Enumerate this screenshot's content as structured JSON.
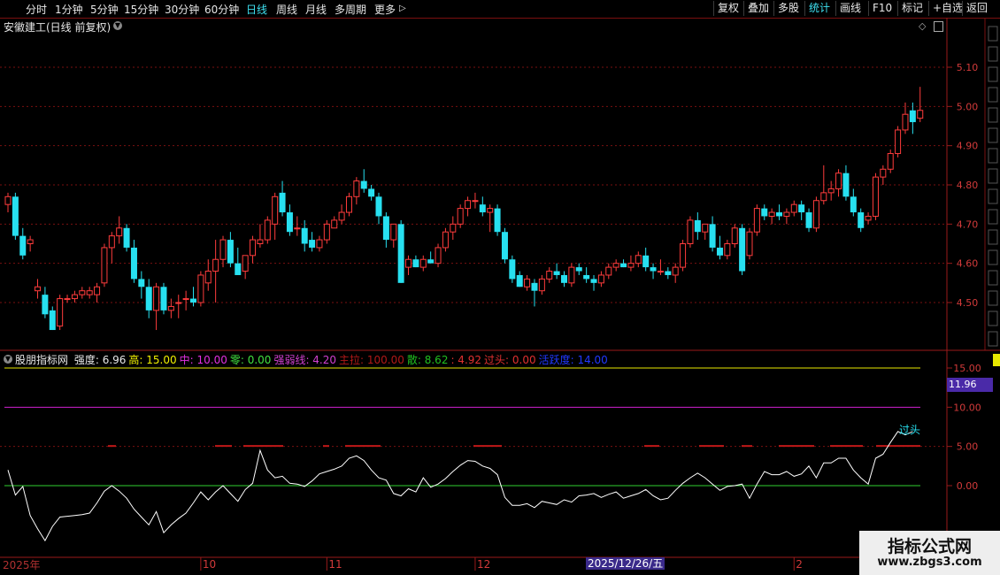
{
  "toolbar": {
    "periods": [
      "分时",
      "1分钟",
      "5分钟",
      "15分钟",
      "30分钟",
      "60分钟",
      "日线",
      "周线",
      "月线",
      "多周期",
      "更多"
    ],
    "active_period": "日线",
    "right_buttons": [
      "复权",
      "叠加",
      "多股",
      "统计",
      "画线",
      "F10",
      "标记",
      "+自选",
      "返回"
    ],
    "active_right": "统计"
  },
  "stock": {
    "title": "安徽建工(日线 前复权)"
  },
  "price_axis": {
    "labels": [
      "5.10",
      "5.00",
      "4.90",
      "4.80",
      "4.70",
      "4.60",
      "4.50"
    ]
  },
  "indicator": {
    "name": "股朋指标网",
    "items": [
      {
        "label": "强度: 6.96",
        "color": "#e8e8e8"
      },
      {
        "label": "高: 15.00",
        "color": "#f0f000"
      },
      {
        "label": "中: 10.00",
        "color": "#e030e0"
      },
      {
        "label": "零: 0.00",
        "color": "#40e040"
      },
      {
        "label": "强弱线: 4.20",
        "color": "#d040d0"
      },
      {
        "label": "主拉: 100.00",
        "color": "#b01818"
      },
      {
        "label": "散: 8.62",
        "color": "#20c020"
      },
      {
        "label": ": 4.92",
        "color": "#e03030"
      },
      {
        "label": "过头: 0.00",
        "color": "#e03030"
      },
      {
        "label": "活跃度: 14.00",
        "color": "#2038ff"
      }
    ],
    "axis_labels": [
      "15.00",
      "10.00",
      "5.00",
      "0.00"
    ],
    "current_value": "11.96",
    "annotation": "过头"
  },
  "time_axis": {
    "labels": [
      {
        "text": "2025年",
        "idx": 0
      },
      {
        "text": "10",
        "idx": 26
      },
      {
        "text": "11",
        "idx": 43
      },
      {
        "text": "12",
        "idx": 63
      },
      {
        "text": "2",
        "idx": 106
      }
    ],
    "selected_date": "2025/12/26/五"
  },
  "watermark": {
    "line1": "指标公式网",
    "line2": "www.zbgs3.com"
  },
  "colors": {
    "up": "#ff3c3c",
    "down": "#27e0f0",
    "grid": "#7a1010",
    "osc": "#ffffff",
    "bg": "#000000"
  },
  "chart_data": {
    "type": "candlestick",
    "ohlc": [
      [
        4.75,
        4.78,
        4.73,
        4.77
      ],
      [
        4.77,
        4.78,
        4.66,
        4.67
      ],
      [
        4.67,
        4.69,
        4.61,
        4.62
      ],
      [
        4.65,
        4.67,
        4.63,
        4.66
      ],
      [
        4.53,
        4.56,
        4.51,
        4.54
      ],
      [
        4.52,
        4.54,
        4.46,
        4.47
      ],
      [
        4.48,
        4.49,
        4.43,
        4.43
      ],
      [
        4.44,
        4.52,
        4.43,
        4.51
      ],
      [
        4.51,
        4.52,
        4.5,
        4.51
      ],
      [
        4.51,
        4.53,
        4.5,
        4.52
      ],
      [
        4.52,
        4.54,
        4.51,
        4.53
      ],
      [
        4.52,
        4.54,
        4.51,
        4.53
      ],
      [
        4.52,
        4.55,
        4.5,
        4.54
      ],
      [
        4.55,
        4.65,
        4.54,
        4.64
      ],
      [
        4.64,
        4.68,
        4.6,
        4.67
      ],
      [
        4.67,
        4.72,
        4.65,
        4.69
      ],
      [
        4.69,
        4.7,
        4.63,
        4.64
      ],
      [
        4.64,
        4.66,
        4.55,
        4.56
      ],
      [
        4.56,
        4.58,
        4.51,
        4.54
      ],
      [
        4.54,
        4.56,
        4.46,
        4.48
      ],
      [
        4.48,
        4.55,
        4.43,
        4.54
      ],
      [
        4.54,
        4.55,
        4.47,
        4.48
      ],
      [
        4.48,
        4.51,
        4.46,
        4.49
      ],
      [
        4.5,
        4.52,
        4.46,
        4.5
      ],
      [
        4.51,
        4.53,
        4.48,
        4.51
      ],
      [
        4.51,
        4.54,
        4.49,
        4.5
      ],
      [
        4.5,
        4.58,
        4.49,
        4.57
      ],
      [
        4.55,
        4.61,
        4.53,
        4.58
      ],
      [
        4.58,
        4.66,
        4.5,
        4.61
      ],
      [
        4.61,
        4.67,
        4.59,
        4.66
      ],
      [
        4.66,
        4.68,
        4.59,
        4.6
      ],
      [
        4.6,
        4.64,
        4.57,
        4.57
      ],
      [
        4.58,
        4.62,
        4.56,
        4.62
      ],
      [
        4.62,
        4.67,
        4.6,
        4.66
      ],
      [
        4.65,
        4.7,
        4.64,
        4.66
      ],
      [
        4.66,
        4.72,
        4.65,
        4.71
      ],
      [
        4.7,
        4.78,
        4.66,
        4.77
      ],
      [
        4.78,
        4.81,
        4.72,
        4.73
      ],
      [
        4.73,
        4.75,
        4.67,
        4.68
      ],
      [
        4.69,
        4.72,
        4.67,
        4.69
      ],
      [
        4.69,
        4.71,
        4.63,
        4.65
      ],
      [
        4.66,
        4.68,
        4.63,
        4.64
      ],
      [
        4.64,
        4.67,
        4.63,
        4.66
      ],
      [
        4.66,
        4.71,
        4.65,
        4.7
      ],
      [
        4.69,
        4.72,
        4.69,
        4.71
      ],
      [
        4.71,
        4.75,
        4.7,
        4.73
      ],
      [
        4.73,
        4.78,
        4.72,
        4.77
      ],
      [
        4.77,
        4.82,
        4.75,
        4.81
      ],
      [
        4.81,
        4.84,
        4.78,
        4.79
      ],
      [
        4.79,
        4.8,
        4.76,
        4.77
      ],
      [
        4.77,
        4.78,
        4.7,
        4.72
      ],
      [
        4.72,
        4.73,
        4.64,
        4.66
      ],
      [
        4.66,
        4.7,
        4.64,
        4.7
      ],
      [
        4.7,
        4.71,
        4.55,
        4.55
      ],
      [
        4.59,
        4.62,
        4.57,
        4.61
      ],
      [
        4.61,
        4.62,
        4.59,
        4.59
      ],
      [
        4.59,
        4.62,
        4.58,
        4.61
      ],
      [
        4.61,
        4.63,
        4.6,
        4.6
      ],
      [
        4.6,
        4.65,
        4.59,
        4.64
      ],
      [
        4.64,
        4.69,
        4.63,
        4.68
      ],
      [
        4.68,
        4.72,
        4.66,
        4.7
      ],
      [
        4.7,
        4.75,
        4.69,
        4.74
      ],
      [
        4.74,
        4.77,
        4.72,
        4.76
      ],
      [
        4.76,
        4.78,
        4.74,
        4.76
      ],
      [
        4.75,
        4.77,
        4.72,
        4.73
      ],
      [
        4.73,
        4.75,
        4.68,
        4.74
      ],
      [
        4.74,
        4.75,
        4.67,
        4.68
      ],
      [
        4.68,
        4.69,
        4.6,
        4.61
      ],
      [
        4.61,
        4.62,
        4.55,
        4.56
      ],
      [
        4.57,
        4.58,
        4.54,
        4.54
      ],
      [
        4.54,
        4.57,
        4.53,
        4.56
      ],
      [
        4.55,
        4.56,
        4.49,
        4.53
      ],
      [
        4.53,
        4.57,
        4.52,
        4.56
      ],
      [
        4.56,
        4.59,
        4.55,
        4.58
      ],
      [
        4.58,
        4.6,
        4.56,
        4.57
      ],
      [
        4.57,
        4.58,
        4.54,
        4.55
      ],
      [
        4.55,
        4.6,
        4.54,
        4.59
      ],
      [
        4.59,
        4.6,
        4.57,
        4.58
      ],
      [
        4.57,
        4.59,
        4.55,
        4.56
      ],
      [
        4.56,
        4.57,
        4.53,
        4.55
      ],
      [
        4.55,
        4.58,
        4.54,
        4.57
      ],
      [
        4.57,
        4.6,
        4.56,
        4.59
      ],
      [
        4.59,
        4.61,
        4.58,
        4.6
      ],
      [
        4.6,
        4.61,
        4.59,
        4.59
      ],
      [
        4.59,
        4.62,
        4.58,
        4.6
      ],
      [
        4.6,
        4.63,
        4.59,
        4.62
      ],
      [
        4.62,
        4.64,
        4.58,
        4.59
      ],
      [
        4.59,
        4.6,
        4.56,
        4.58
      ],
      [
        4.58,
        4.61,
        4.57,
        4.58
      ],
      [
        4.58,
        4.59,
        4.56,
        4.57
      ],
      [
        4.57,
        4.6,
        4.55,
        4.59
      ],
      [
        4.59,
        4.66,
        4.58,
        4.65
      ],
      [
        4.65,
        4.72,
        4.64,
        4.71
      ],
      [
        4.71,
        4.73,
        4.66,
        4.68
      ],
      [
        4.68,
        4.7,
        4.66,
        4.7
      ],
      [
        4.7,
        4.72,
        4.63,
        4.64
      ],
      [
        4.64,
        4.67,
        4.61,
        4.62
      ],
      [
        4.62,
        4.66,
        4.61,
        4.65
      ],
      [
        4.65,
        4.7,
        4.64,
        4.69
      ],
      [
        4.69,
        4.7,
        4.57,
        4.58
      ],
      [
        4.62,
        4.69,
        4.61,
        4.68
      ],
      [
        4.68,
        4.75,
        4.67,
        4.74
      ],
      [
        4.74,
        4.75,
        4.71,
        4.72
      ],
      [
        4.72,
        4.74,
        4.7,
        4.73
      ],
      [
        4.73,
        4.75,
        4.71,
        4.72
      ],
      [
        4.72,
        4.74,
        4.7,
        4.73
      ],
      [
        4.73,
        4.76,
        4.72,
        4.75
      ],
      [
        4.75,
        4.76,
        4.71,
        4.73
      ],
      [
        4.73,
        4.74,
        4.68,
        4.69
      ],
      [
        4.69,
        4.77,
        4.68,
        4.76
      ],
      [
        4.76,
        4.85,
        4.75,
        4.78
      ],
      [
        4.78,
        4.81,
        4.76,
        4.79
      ],
      [
        4.79,
        4.84,
        4.77,
        4.83
      ],
      [
        4.83,
        4.85,
        4.76,
        4.77
      ],
      [
        4.77,
        4.79,
        4.72,
        4.73
      ],
      [
        4.73,
        4.74,
        4.68,
        4.69
      ],
      [
        4.71,
        4.73,
        4.7,
        4.72
      ],
      [
        4.72,
        4.83,
        4.71,
        4.82
      ],
      [
        4.82,
        4.85,
        4.8,
        4.84
      ],
      [
        4.84,
        4.89,
        4.83,
        4.88
      ],
      [
        4.88,
        4.95,
        4.87,
        4.94
      ],
      [
        4.94,
        5.01,
        4.93,
        4.98
      ],
      [
        4.99,
        5.01,
        4.93,
        4.96
      ],
      [
        4.97,
        5.05,
        4.96,
        4.99
      ]
    ],
    "oscillator": [
      2.0,
      -1.2,
      -0.1,
      -3.8,
      -5.5,
      -7.0,
      -5.2,
      -4.0,
      -3.9,
      -3.8,
      -3.7,
      -3.5,
      -2.2,
      -0.7,
      0.0,
      -0.7,
      -1.6,
      -3.0,
      -4.0,
      -5.0,
      -3.3,
      -6.0,
      -5.0,
      -4.2,
      -3.5,
      -2.2,
      -0.8,
      -1.8,
      -0.8,
      0.0,
      -1.0,
      -2.0,
      -0.5,
      0.3,
      4.5,
      2.0,
      1.0,
      1.2,
      0.3,
      0.2,
      -0.1,
      0.6,
      1.5,
      1.8,
      2.1,
      2.5,
      3.5,
      3.8,
      3.2,
      2.0,
      1.0,
      0.7,
      -1.0,
      -1.3,
      -0.4,
      -0.8,
      1.0,
      -0.2,
      0.2,
      0.9,
      1.8,
      2.6,
      3.2,
      3.1,
      2.5,
      2.2,
      1.4,
      -1.5,
      -2.5,
      -2.5,
      -2.3,
      -2.8,
      -2.0,
      -2.2,
      -2.4,
      -1.8,
      -2.1,
      -1.3,
      -1.2,
      -1.0,
      -1.5,
      -1.1,
      -0.8,
      -1.6,
      -1.3,
      -1.0,
      -0.5,
      -1.3,
      -1.8,
      -1.6,
      -0.6,
      0.3,
      1.0,
      1.6,
      1.0,
      0.2,
      -0.6,
      -0.1,
      0.0,
      0.2,
      -1.6,
      0.2,
      1.8,
      1.4,
      1.4,
      1.8,
      1.2,
      1.5,
      2.5,
      1.0,
      2.9,
      2.9,
      3.5,
      3.5,
      2.0,
      1.0,
      0.2,
      3.5,
      4.0,
      5.5,
      6.9,
      6.5,
      6.9
    ],
    "lines": [
      {
        "name": "高",
        "value": 15
      },
      {
        "name": "中",
        "value": 10
      },
      {
        "name": "零",
        "value": 0
      }
    ],
    "price_range": [
      4.43,
      5.18
    ],
    "indicator_range": [
      -9.5,
      17.5
    ]
  }
}
